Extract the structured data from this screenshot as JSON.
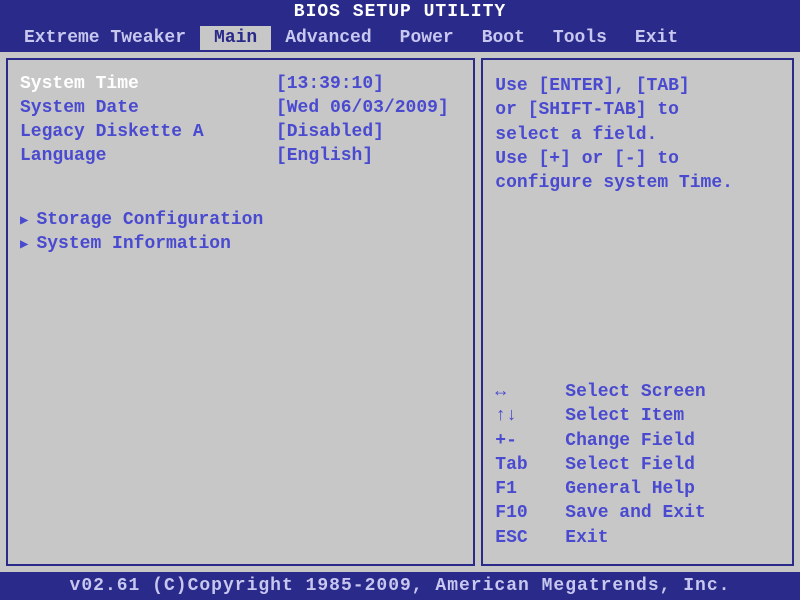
{
  "title": "BIOS SETUP UTILITY",
  "menu": {
    "items": [
      {
        "label": "Extreme Tweaker",
        "active": false
      },
      {
        "label": "Main",
        "active": true
      },
      {
        "label": "Advanced",
        "active": false
      },
      {
        "label": "Power",
        "active": false
      },
      {
        "label": "Boot",
        "active": false
      },
      {
        "label": "Tools",
        "active": false
      },
      {
        "label": "Exit",
        "active": false
      }
    ]
  },
  "main": {
    "fields": [
      {
        "label": "System Time",
        "value": "[13:39:10]",
        "selected": true
      },
      {
        "label": "System Date",
        "value": "[Wed 06/03/2009]",
        "selected": false
      },
      {
        "label": "Legacy Diskette A",
        "value": "[Disabled]",
        "selected": false
      },
      {
        "label": "Language",
        "value": "[English]",
        "selected": false
      }
    ],
    "submenus": [
      {
        "label": "Storage Configuration"
      },
      {
        "label": "System Information"
      }
    ]
  },
  "help": {
    "top_lines": [
      "Use [ENTER], [TAB]",
      "or [SHIFT-TAB] to",
      "select a field.",
      "",
      "Use [+] or [-] to",
      "configure system Time."
    ],
    "keys": [
      {
        "key": "↔",
        "desc": "Select Screen"
      },
      {
        "key": "↑↓",
        "desc": "Select Item"
      },
      {
        "key": "+-",
        "desc": "Change Field"
      },
      {
        "key": "Tab",
        "desc": "Select Field"
      },
      {
        "key": "F1",
        "desc": "General Help"
      },
      {
        "key": "F10",
        "desc": "Save and Exit"
      },
      {
        "key": "ESC",
        "desc": "Exit"
      }
    ]
  },
  "footer": "v02.61 (C)Copyright 1985-2009, American Megatrends, Inc."
}
